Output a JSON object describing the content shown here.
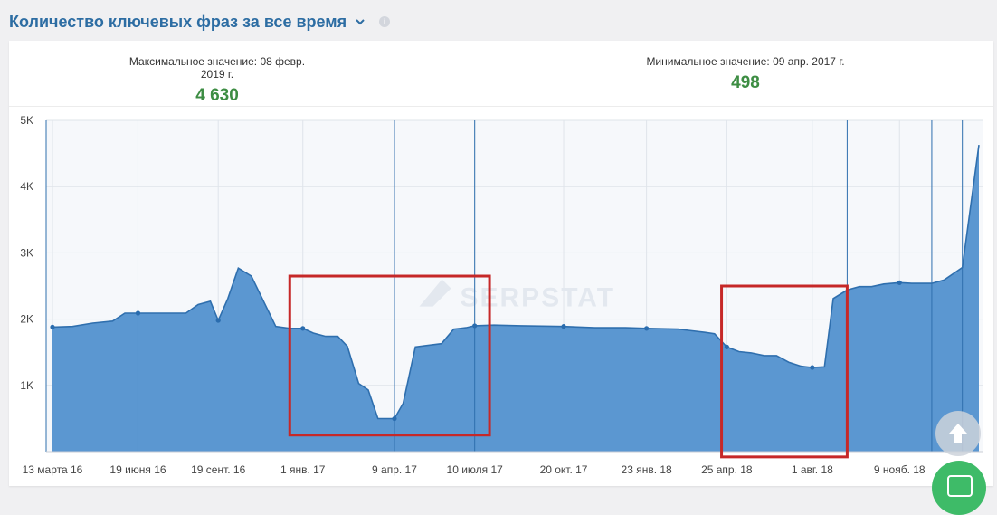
{
  "header": {
    "title": "Количество ключевых фраз за все время",
    "chevron_icon": "chevron-down-icon",
    "info_icon": "info-icon",
    "info_glyph": "i"
  },
  "stats": {
    "max_label": "Максимальное значение: 08 февр. 2019 г.",
    "max_value": "4 630",
    "min_label": "Минимальное значение: 09 апр. 2017 г.",
    "min_value": "498"
  },
  "watermark": "SERPSTAT",
  "colors": {
    "title": "#2d6da3",
    "stat_value": "#3d8d43",
    "area_fill": "#5b97d1",
    "area_line": "#2f6fae",
    "highlight_box": "#c62828",
    "chat_button": "#3ebb68"
  },
  "chart_data": {
    "type": "area",
    "title": "",
    "xlabel": "",
    "ylabel": "",
    "ylim": [
      0,
      5000
    ],
    "yticks": [
      "5K",
      "4K",
      "3K",
      "2K",
      "1K"
    ],
    "ytick_values": [
      5000,
      4000,
      3000,
      2000,
      1000
    ],
    "xtick_labels": [
      "13 марта 16",
      "19 июня 16",
      "19 сент. 16",
      "1 янв. 17",
      "9 апр. 17",
      "10 июля 17",
      "20 окт. 17",
      "23 янв. 18",
      "25 апр. 18",
      "1 авг. 18",
      "9 нояб. 18"
    ],
    "grid": true,
    "legend": "none",
    "series": [
      {
        "x": [
          "2016-03-13",
          "2016-04-05",
          "2016-04-28",
          "2016-05-21",
          "2016-06-04",
          "2016-06-19",
          "2016-07-16",
          "2016-08-13",
          "2016-08-27",
          "2016-09-10",
          "2016-09-19",
          "2016-09-30",
          "2016-10-12",
          "2016-10-27",
          "2016-11-24",
          "2016-12-10",
          "2016-12-25",
          "2017-01-06",
          "2017-01-20",
          "2017-02-03",
          "2017-02-14",
          "2017-02-27",
          "2017-03-10",
          "2017-03-21",
          "2017-04-09",
          "2017-04-19",
          "2017-05-03",
          "2017-06-02",
          "2017-06-16",
          "2017-06-30",
          "2017-07-10",
          "2017-08-01",
          "2017-09-01",
          "2017-10-20",
          "2017-11-25",
          "2017-12-30",
          "2018-01-23",
          "2018-02-28",
          "2018-03-31",
          "2018-04-11",
          "2018-04-25",
          "2018-05-09",
          "2018-05-23",
          "2018-06-07",
          "2018-06-21",
          "2018-07-05",
          "2018-07-19",
          "2018-08-01",
          "2018-08-15",
          "2018-08-25",
          "2018-09-10",
          "2018-09-24",
          "2018-10-08",
          "2018-10-22",
          "2018-11-09",
          "2018-11-23",
          "2018-12-16",
          "2018-12-30",
          "2019-01-20",
          "2019-02-08"
        ],
        "values": [
          1880,
          1890,
          1940,
          1970,
          2090,
          2090,
          2090,
          2090,
          2220,
          2270,
          1980,
          2310,
          2770,
          2650,
          1890,
          1860,
          1860,
          1790,
          1740,
          1740,
          1590,
          1030,
          930,
          500,
          498,
          730,
          1580,
          1630,
          1850,
          1870,
          1900,
          1910,
          1900,
          1890,
          1870,
          1870,
          1860,
          1850,
          1800,
          1780,
          1580,
          1510,
          1490,
          1450,
          1450,
          1350,
          1290,
          1270,
          1280,
          2310,
          2440,
          2490,
          2490,
          2530,
          2550,
          2540,
          2540,
          2590,
          2780,
          4630
        ]
      }
    ],
    "marker_dates": [
      "2016-03-13",
      "2016-06-19",
      "2016-09-19",
      "2016-12-25",
      "2017-04-09",
      "2017-07-10",
      "2017-10-20",
      "2018-01-23",
      "2018-04-25",
      "2018-08-01",
      "2018-11-09"
    ],
    "vertical_lines": [
      "2016-06-19",
      "2017-04-09",
      "2017-07-10",
      "2018-09-10",
      "2018-12-16",
      "2019-01-20"
    ],
    "highlight_ranges": [
      {
        "from": "2016-12-10",
        "to": "2017-07-27",
        "low": 250,
        "high": 2650
      },
      {
        "from": "2018-04-19",
        "to": "2018-09-10",
        "low": -80,
        "high": 2500
      }
    ]
  }
}
